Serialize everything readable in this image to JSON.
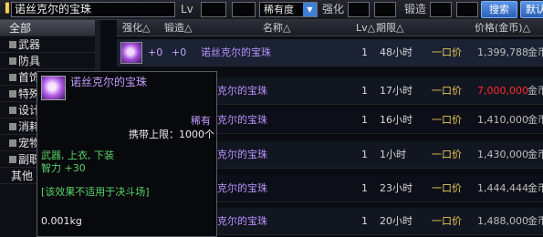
{
  "search": {
    "query": "诺丝克尔的宝珠",
    "lv_label": "Lv",
    "rarity_value": "稀有度",
    "strengthen_label": "强化",
    "forge_label": "锻造",
    "search_button": "搜索",
    "default_button": "默认"
  },
  "categories": [
    {
      "label": "全部"
    },
    {
      "label": "武器"
    },
    {
      "label": "防具"
    },
    {
      "label": "首饰"
    },
    {
      "label": "特殊"
    },
    {
      "label": "设计"
    },
    {
      "label": "消耗"
    },
    {
      "label": "宠物"
    },
    {
      "label": "副职"
    },
    {
      "label": "其他"
    }
  ],
  "table": {
    "headers": {
      "strengthen": "强化△",
      "forge": "锻造△",
      "name": "名称△",
      "lv": "Lv△",
      "time": "期限△",
      "price": "价格(金币)△"
    },
    "rows": [
      {
        "strengthen": "+0",
        "forge": "+0",
        "name": "诺丝克尔的宝珠",
        "lv": "1",
        "time": "48小时",
        "type": "一口价",
        "price": "1,399,788",
        "currency": "金币"
      },
      {
        "name": "克尔的宝珠",
        "lv": "1",
        "time": "17小时",
        "type": "一口价",
        "price": "7,000,000",
        "currency": "金币"
      },
      {
        "name": "克尔的宝珠",
        "lv": "1",
        "time": "16小时",
        "type": "一口价",
        "price": "1,410,000",
        "currency": "金币"
      },
      {
        "name": "克尔的宝珠",
        "lv": "1",
        "time": "1小时",
        "type": "一口价",
        "price": "1,430,000",
        "currency": "金币"
      },
      {
        "name": "克尔的宝珠",
        "lv": "1",
        "time": "23小时",
        "type": "一口价",
        "price": "1,444,444",
        "currency": "金币"
      },
      {
        "name": "克尔的宝珠",
        "lv": "1",
        "time": "20小时",
        "type": "一口价",
        "price": "1,488,000",
        "currency": "金币"
      }
    ]
  },
  "tooltip": {
    "name": "诺丝克尔的宝珠",
    "rarity": "稀有",
    "carry_limit": "携带上限：1000个",
    "equip_types": "武器, 上衣, 下装",
    "stat": "智力 +30",
    "note": "[该效果不适用于决斗场]",
    "weight": "0.001kg"
  },
  "colors": {
    "accent": "#3e7fd6",
    "rare_text": "#c59bff",
    "price_alert": "#ff2a2a",
    "tooltip_green": "#58d36a",
    "buyout_gold": "#e7c65a"
  }
}
